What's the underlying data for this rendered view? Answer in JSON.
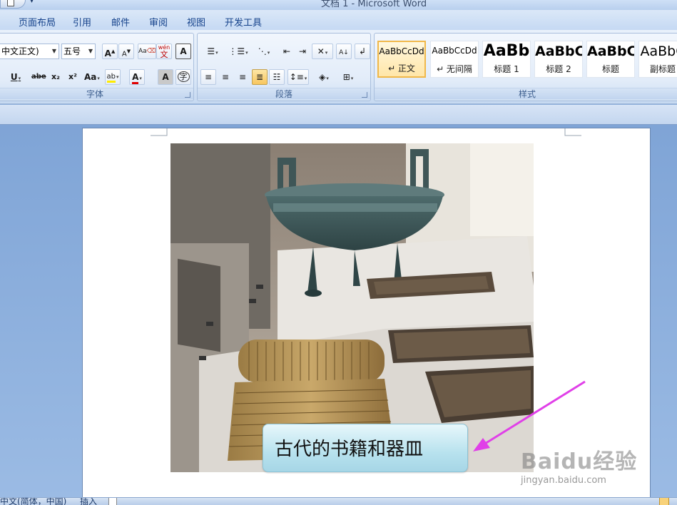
{
  "window": {
    "title": "文档 1 - Microsoft Word"
  },
  "tabs": [
    "页面布局",
    "引用",
    "邮件",
    "审阅",
    "视图",
    "开发工具"
  ],
  "ribbon": {
    "font_group": {
      "label": "字体",
      "font_name": "中文正文)",
      "font_size": "五号",
      "grow": "A",
      "shrink": "A",
      "underline": "U",
      "strike": "abe",
      "subscript": "x₂",
      "superscript": "x²",
      "change_case": "Aa",
      "highlight": "ab",
      "font_color": "A",
      "shade": "A",
      "phonetic": "wén",
      "phonetic_char": "文",
      "border_char": "A",
      "enclose_char": "字"
    },
    "paragraph_group": {
      "label": "段落"
    },
    "styles_group": {
      "label": "样式",
      "tiles": [
        {
          "sample": "AaBbCcDd",
          "name": "↵ 正文",
          "selected": true
        },
        {
          "sample": "AaBbCcDd",
          "name": "↵ 无间隔",
          "selected": false
        },
        {
          "sample": "AaBb",
          "name": "标题 1",
          "selected": false
        },
        {
          "sample": "AaBbC",
          "name": "标题 2",
          "selected": false
        },
        {
          "sample": "AaBbC",
          "name": "标题",
          "selected": false
        },
        {
          "sample": "AaBbC",
          "name": "副标题",
          "selected": false
        }
      ]
    }
  },
  "document": {
    "callout_text": "古代的书籍和器皿",
    "watermark_logo": "Baidu经验",
    "watermark_url": "jingyan.baidu.com",
    "arrow_color": "#e040e8"
  },
  "statusbar": {
    "language": "中文(简体，中国)",
    "mode": "插入"
  }
}
